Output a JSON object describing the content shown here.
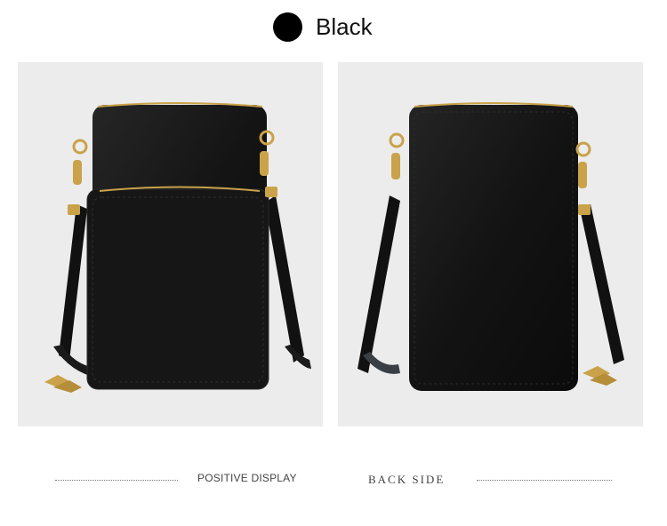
{
  "color_option": {
    "label": "Black",
    "swatch_color": "#000000"
  },
  "photos": {
    "front_view": "front view of black leather phone crossbody bag",
    "back_view": "back view of black leather phone crossbody bag"
  },
  "captions": {
    "front": "POSITIVE DISPLAY",
    "back": "BACK SIDE"
  },
  "colors": {
    "panel_background": "#ececec",
    "leather": "#141414",
    "hardware": "#c9a24a"
  }
}
